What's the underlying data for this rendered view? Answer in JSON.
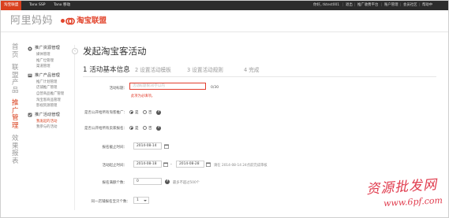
{
  "topbar": {
    "tabs": [
      "淘宝联盟",
      "Tanx SSP",
      "Tanx 移动"
    ],
    "greeting": "你好，",
    "username": "tktest001",
    "logout": "退出",
    "links": [
      "推广收费平台",
      "账户管理",
      "会员社区",
      "帮助中"
    ]
  },
  "brand": {
    "alimama": "阿里妈妈",
    "taobao_union": "淘宝联盟"
  },
  "left_nav": [
    "首页",
    "联盟产品",
    "推广管理",
    "效果报表"
  ],
  "submenu": [
    {
      "title": "推广资源管理",
      "items": [
        "媒体管理",
        "推广位管理",
        "渠道管理"
      ]
    },
    {
      "title": "推广产品管理",
      "items": [
        "推广计划管理",
        "店铺推广管理",
        "自营商品推广管理",
        "淘宝客商品管理",
        "影视资源管理"
      ]
    },
    {
      "title": "推广活动管理",
      "items": [
        "我发起的活动",
        "我参与的活动"
      ]
    }
  ],
  "page": {
    "title": "发起淘宝客活动",
    "steps": [
      "1 活动基本信息",
      "2 设置活动模板",
      "3 设置活动规则",
      "4 完成"
    ]
  },
  "form": {
    "activity_title_label": "活动标题：",
    "activity_title_placeholder": "活动标题限30字以内",
    "activity_title_count": "0/30",
    "activity_title_error": "此项为必填项。",
    "q1_label": "是否公开给所有淘客推广：",
    "q2_label": "是否公开给所有卖家报名：",
    "yes": "是",
    "no": "否",
    "deadline_label": "报名截止时间：",
    "deadline_value": "2014-08-14",
    "period_label": "活动起止时间：",
    "period_start": "2014-08-18",
    "period_end": "2014-08-28",
    "period_hint": "请在 2014-08-14 24点前完成审核",
    "quota_label": "报名满额个数：",
    "quota_value": "0",
    "quota_hint": "最多不超过500个",
    "per_seller_label": "同一店铺报名宝贝个数：",
    "per_seller_value": "1"
  },
  "watermark": {
    "line1": "资源批发网",
    "line2": "www.6pf.com"
  },
  "colors": {
    "accent": "#d9401e",
    "topbar": "#2c2c2c",
    "error": "#e23d2d",
    "watermark": "#e03a4c"
  }
}
